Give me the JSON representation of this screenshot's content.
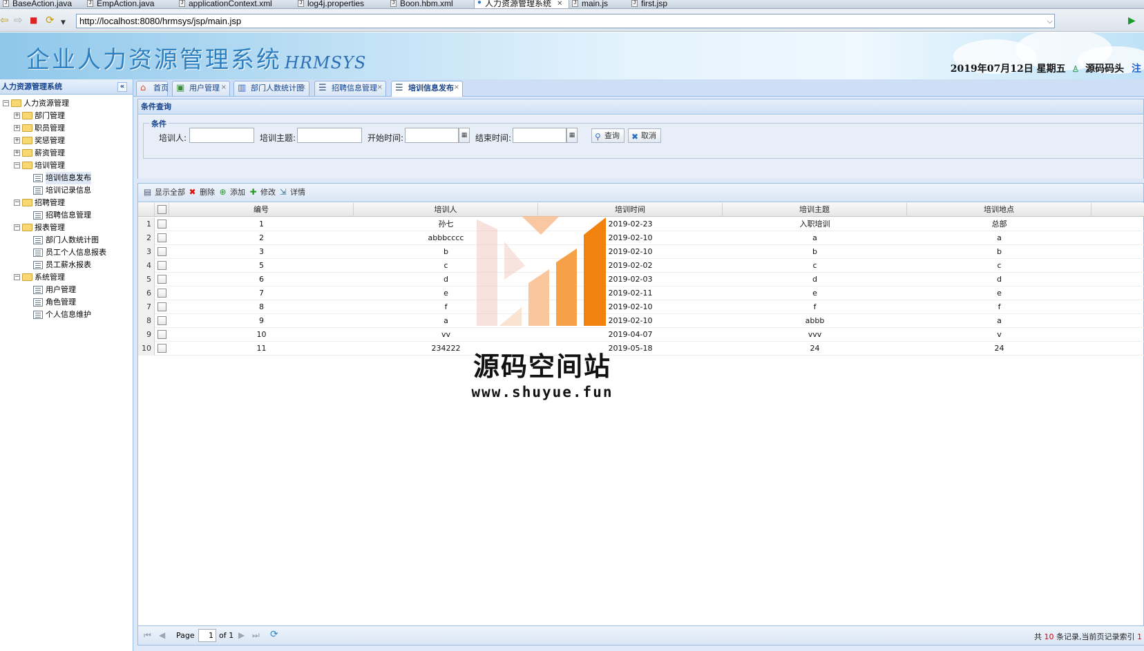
{
  "editor_tabs": [
    {
      "label": "BaseAction.java",
      "icon": "java-file-icon"
    },
    {
      "label": "EmpAction.java",
      "icon": "java-file-icon"
    },
    {
      "label": "applicationContext.xml",
      "icon": "xml-file-icon"
    },
    {
      "label": "log4j.properties",
      "icon": "properties-file-icon"
    },
    {
      "label": "Boon.hbm.xml",
      "icon": "xml-file-icon"
    },
    {
      "label": "人力资源管理系统",
      "icon": "globe-icon",
      "active": true
    },
    {
      "label": "main.js",
      "icon": "js-file-icon"
    },
    {
      "label": "first.jsp",
      "icon": "jsp-file-icon"
    }
  ],
  "browser": {
    "url": "http://localhost:8080/hrmsys/jsp/main.jsp"
  },
  "header": {
    "title": "企业人力资源管理系统",
    "subtitle": "HRMSYS",
    "date": "2019年07月12日 星期五",
    "user": "源码码头",
    "logout": "注"
  },
  "sidebar": {
    "title": "人力资源管理系统",
    "tree": [
      {
        "label": "人力资源管理",
        "level": 0,
        "type": "folder",
        "expanded": true
      },
      {
        "label": "部门管理",
        "level": 1,
        "type": "folder",
        "expanded": false
      },
      {
        "label": "职员管理",
        "level": 1,
        "type": "folder",
        "expanded": false
      },
      {
        "label": "奖惩管理",
        "level": 1,
        "type": "folder",
        "expanded": false
      },
      {
        "label": "薪资管理",
        "level": 1,
        "type": "folder",
        "expanded": false
      },
      {
        "label": "培训管理",
        "level": 1,
        "type": "folder",
        "expanded": true
      },
      {
        "label": "培训信息发布",
        "level": 2,
        "type": "leaf",
        "selected": true
      },
      {
        "label": "培训记录信息",
        "level": 2,
        "type": "leaf"
      },
      {
        "label": "招聘管理",
        "level": 1,
        "type": "folder",
        "expanded": true
      },
      {
        "label": "招聘信息管理",
        "level": 2,
        "type": "leaf"
      },
      {
        "label": "报表管理",
        "level": 1,
        "type": "folder",
        "expanded": true
      },
      {
        "label": "部门人数统计图",
        "level": 2,
        "type": "leaf"
      },
      {
        "label": "员工个人信息报表",
        "level": 2,
        "type": "leaf"
      },
      {
        "label": "员工薪水报表",
        "level": 2,
        "type": "leaf"
      },
      {
        "label": "系统管理",
        "level": 1,
        "type": "folder",
        "expanded": true
      },
      {
        "label": "用户管理",
        "level": 2,
        "type": "leaf"
      },
      {
        "label": "角色管理",
        "level": 2,
        "type": "leaf"
      },
      {
        "label": "个人信息维护",
        "level": 2,
        "type": "leaf"
      }
    ]
  },
  "app_tabs": [
    {
      "label": "首页",
      "icon": "home-icon",
      "closable": false
    },
    {
      "label": "用户管理",
      "icon": "user-card-icon",
      "closable": true
    },
    {
      "label": "部门人数统计图",
      "icon": "bar-chart-icon",
      "closable": true
    },
    {
      "label": "招聘信息管理",
      "icon": "list-icon",
      "closable": true
    },
    {
      "label": "培训信息发布",
      "icon": "list-icon",
      "closable": true,
      "active": true
    }
  ],
  "query": {
    "panel_title": "条件查询",
    "legend": "条件",
    "trainer_label": "培训人:",
    "topic_label": "培训主题:",
    "start_label": "开始时间:",
    "end_label": "结束时间:",
    "trainer_value": "",
    "topic_value": "",
    "start_value": "",
    "end_value": "",
    "search_button": "查询",
    "cancel_button": "取消"
  },
  "toolbar": {
    "show_all": "显示全部",
    "delete": "删除",
    "add": "添加",
    "edit": "修改",
    "detail": "详情"
  },
  "grid": {
    "columns": [
      "编号",
      "培训人",
      "培训时间",
      "培训主题",
      "培训地点"
    ],
    "rows": [
      [
        "1",
        "孙七",
        "2019-02-23",
        "入职培训",
        "总部"
      ],
      [
        "2",
        "abbbcccc",
        "2019-02-10",
        "a",
        "a"
      ],
      [
        "3",
        "b",
        "2019-02-10",
        "b",
        "b"
      ],
      [
        "5",
        "c",
        "2019-02-02",
        "c",
        "c"
      ],
      [
        "6",
        "d",
        "2019-02-03",
        "d",
        "d"
      ],
      [
        "7",
        "e",
        "2019-02-11",
        "e",
        "e"
      ],
      [
        "8",
        "f",
        "2019-02-10",
        "f",
        "f"
      ],
      [
        "9",
        "a",
        "2019-02-10",
        "abbb",
        "a"
      ],
      [
        "10",
        "vv",
        "2019-04-07",
        "vvv",
        "v"
      ],
      [
        "11",
        "234222",
        "2019-05-18",
        "24",
        "24"
      ]
    ]
  },
  "pager": {
    "page_label": "Page",
    "page_value": "1",
    "of_label": "of 1",
    "info_prefix": "共",
    "info_total": "10",
    "info_suffix": "条记录,当前页记录索引",
    "info_range": "1"
  },
  "watermark": {
    "text": "源码空间站",
    "url": "www.shuyue.fun"
  }
}
